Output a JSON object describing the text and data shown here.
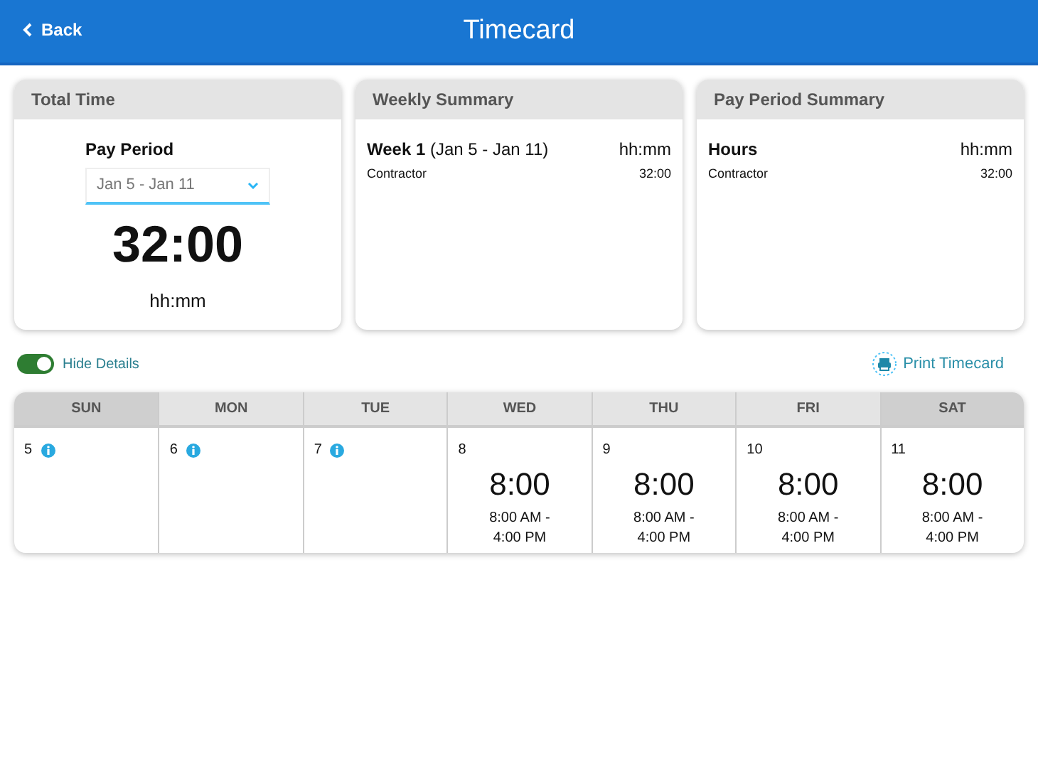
{
  "header": {
    "back": "Back",
    "title": "Timecard"
  },
  "total_time": {
    "title": "Total Time",
    "label": "Pay Period",
    "period": "Jan 5 - Jan 11",
    "total": "32:00",
    "unit": "hh:mm"
  },
  "weekly_summary": {
    "title": "Weekly Summary",
    "heading": "Week 1",
    "heading_detail": "(Jan 5 - Jan 11)",
    "unit": "hh:mm",
    "rows": [
      {
        "label": "Contractor",
        "value": "32:00"
      }
    ]
  },
  "pay_period_summary": {
    "title": "Pay Period Summary",
    "heading": "Hours",
    "unit": "hh:mm",
    "rows": [
      {
        "label": "Contractor",
        "value": "32:00"
      }
    ]
  },
  "hide_details": {
    "label": "Hide Details",
    "on": true
  },
  "print": "Print Timecard",
  "days": [
    {
      "name": "SUN",
      "kind": "weekend",
      "date": "5",
      "info": true
    },
    {
      "name": "MON",
      "kind": "weekday",
      "date": "6",
      "info": true
    },
    {
      "name": "TUE",
      "kind": "weekday",
      "date": "7",
      "info": true
    },
    {
      "name": "WED",
      "kind": "weekday",
      "date": "8",
      "hours": "8:00",
      "range": "8:00 AM - 4:00 PM"
    },
    {
      "name": "THU",
      "kind": "weekday",
      "date": "9",
      "hours": "8:00",
      "range": "8:00 AM - 4:00 PM"
    },
    {
      "name": "FRI",
      "kind": "weekday",
      "date": "10",
      "hours": "8:00",
      "range": "8:00 AM - 4:00 PM"
    },
    {
      "name": "SAT",
      "kind": "weekend",
      "date": "11",
      "hours": "8:00",
      "range": "8:00 AM - 4:00 PM"
    }
  ]
}
